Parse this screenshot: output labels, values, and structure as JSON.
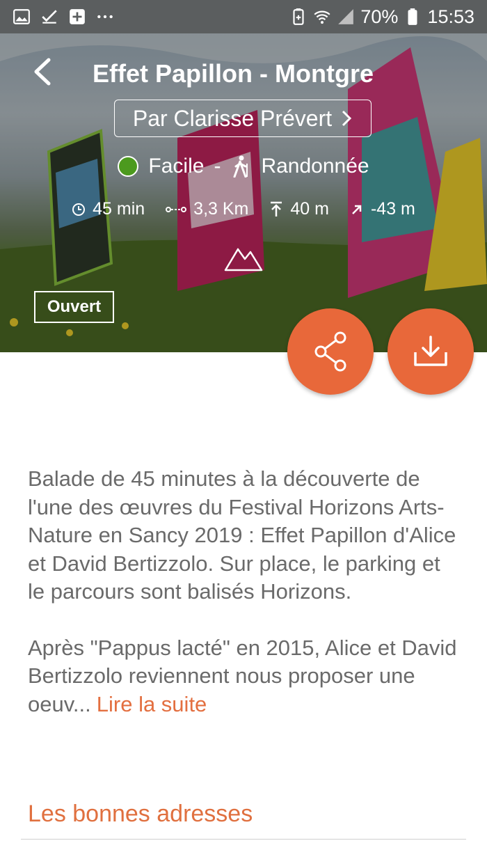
{
  "status_bar": {
    "left_icons": [
      "image-icon",
      "checkbox-icon",
      "plus-box-icon",
      "more-dots-icon"
    ],
    "battery": "70%",
    "time": "15:53"
  },
  "hero": {
    "title": "Effet Papillon - Montgre",
    "author_label": "Par Clarisse Prévert",
    "difficulty": "Facile",
    "separator": "-",
    "activity": "Randonnée",
    "duration": "45 min",
    "distance": "3,3 Km",
    "ascent": "40 m",
    "descent": "-43 m",
    "status_badge": "Ouvert",
    "difficulty_color": "#4c9a1e"
  },
  "actions": {
    "accent_color": "#e8683a"
  },
  "description": {
    "para1": "Balade de 45 minutes à la découverte de l'une des œuvres du Festival Horizons Arts-Nature en Sancy 2019 : Effet Papillon d'Alice et David Bertizzolo. Sur place, le parking et le parcours sont balisés Horizons.",
    "para2": "Après \"Pappus lacté\" en 2015, Alice et David Bertizzolo reviennent nous proposer une oeuv...",
    "read_more": "Lire la suite"
  },
  "section": {
    "title": "Les bonnes adresses"
  }
}
